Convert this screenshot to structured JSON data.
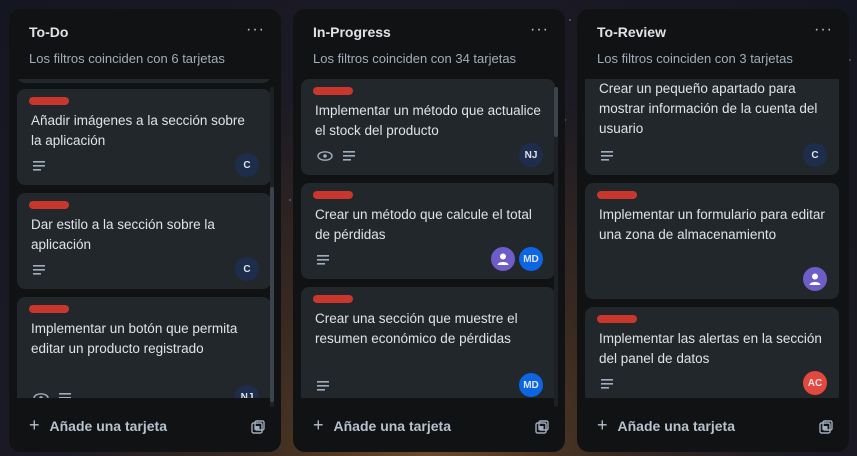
{
  "columns": [
    {
      "title": "To-Do",
      "subtitle": "Los filtros coinciden con 6 tarjetas",
      "add_label": "Añade una tarjeta",
      "cards": [
        {
          "title": "Añadir imágenes a la sección sobre la aplicación",
          "avatar": "C"
        },
        {
          "title": "Dar estilo a la sección sobre la aplicación",
          "avatar": "C"
        },
        {
          "title": "Implementar un botón que permita editar un producto registrado",
          "avatar": "NJ"
        }
      ]
    },
    {
      "title": "In-Progress",
      "subtitle": "Los filtros coinciden con 34 tarjetas",
      "add_label": "Añade una tarjeta",
      "cards": [
        {
          "title": "Implementar un método que actualice el stock del producto",
          "avatar": "NJ"
        },
        {
          "title": "Crear un método que calcule el total de pérdidas",
          "avatar": "MD"
        },
        {
          "title": "Crear una sección que muestre el resumen económico de pérdidas",
          "avatar": "MD"
        }
      ]
    },
    {
      "title": "To-Review",
      "subtitle": "Los filtros coinciden con 3 tarjetas",
      "add_label": "Añade una tarjeta",
      "cards": [
        {
          "title": "Crear un pequeño apartado para mostrar información de la cuenta del usuario",
          "avatar": "C"
        },
        {
          "title": "Implementar un formulario para editar una zona de almacenamiento",
          "avatar": ""
        },
        {
          "title": "Implementar las alertas en la sección del panel de datos",
          "avatar": "AC"
        }
      ]
    }
  ],
  "menu_glyph": "···",
  "colors": {
    "label": "#c9372c",
    "avatar_c": "#1f2d4d",
    "avatar_md": "#0c66e4",
    "avatar_ac": "#e2483d",
    "avatar_user": "#6e5dc6"
  }
}
